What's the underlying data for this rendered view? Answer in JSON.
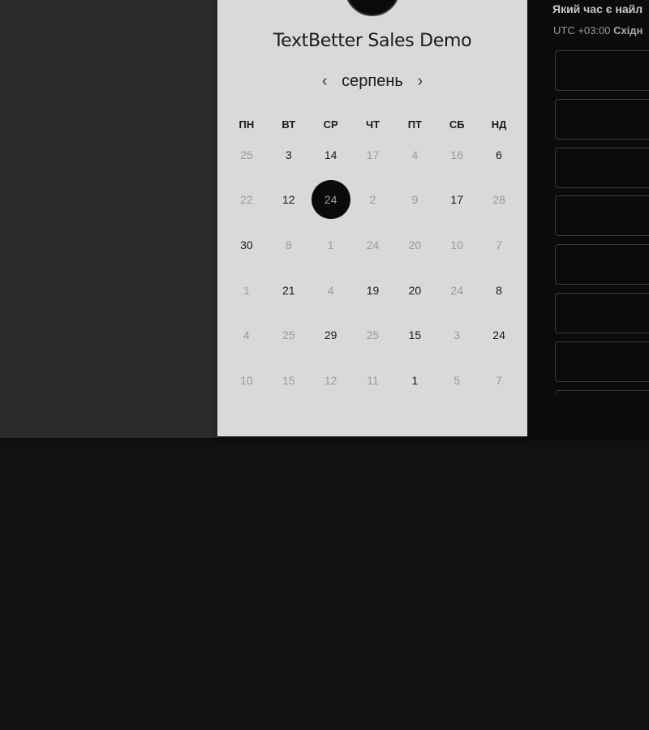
{
  "scheduler": {
    "title": "TextBetter Sales Demo",
    "month": "серпень",
    "prev_icon": "chevron-left-icon",
    "next_icon": "chevron-right-icon",
    "weekdays": [
      "ПН",
      "ВТ",
      "СР",
      "ЧТ",
      "ПТ",
      "СБ",
      "НД"
    ],
    "weeks": [
      [
        {
          "d": "25",
          "dim": true
        },
        {
          "d": "3",
          "dim": false
        },
        {
          "d": "14",
          "dim": false
        },
        {
          "d": "17",
          "dim": true
        },
        {
          "d": "4",
          "dim": true
        },
        {
          "d": "16",
          "dim": true
        },
        {
          "d": "6",
          "dim": false
        }
      ],
      [
        {
          "d": "22",
          "dim": true
        },
        {
          "d": "12",
          "dim": false
        },
        {
          "d": "24",
          "dim": false,
          "selected": true
        },
        {
          "d": "2",
          "dim": true
        },
        {
          "d": "9",
          "dim": true
        },
        {
          "d": "17",
          "dim": false
        },
        {
          "d": "28",
          "dim": true
        }
      ],
      [
        {
          "d": "30",
          "dim": false
        },
        {
          "d": "8",
          "dim": true
        },
        {
          "d": "1",
          "dim": true
        },
        {
          "d": "24",
          "dim": true
        },
        {
          "d": "20",
          "dim": true
        },
        {
          "d": "10",
          "dim": true
        },
        {
          "d": "7",
          "dim": true
        }
      ],
      [
        {
          "d": "1",
          "dim": true
        },
        {
          "d": "21",
          "dim": false
        },
        {
          "d": "4",
          "dim": true
        },
        {
          "d": "19",
          "dim": false
        },
        {
          "d": "20",
          "dim": false
        },
        {
          "d": "24",
          "dim": true
        },
        {
          "d": "8",
          "dim": false
        }
      ],
      [
        {
          "d": "4",
          "dim": true
        },
        {
          "d": "25",
          "dim": true
        },
        {
          "d": "29",
          "dim": false
        },
        {
          "d": "25",
          "dim": true
        },
        {
          "d": "15",
          "dim": false
        },
        {
          "d": "3",
          "dim": true
        },
        {
          "d": "24",
          "dim": false
        }
      ],
      [
        {
          "d": "10",
          "dim": true
        },
        {
          "d": "15",
          "dim": true
        },
        {
          "d": "12",
          "dim": true
        },
        {
          "d": "11",
          "dim": true
        },
        {
          "d": "1",
          "dim": false
        },
        {
          "d": "5",
          "dim": true
        },
        {
          "d": "7",
          "dim": true
        }
      ]
    ]
  },
  "time_panel": {
    "title": "Який час є найл",
    "timezone_prefix": "UTC +03:00",
    "timezone_name": "Східн",
    "slot_count": 7
  },
  "colors": {
    "card_bg": "#d9d9d9",
    "selected_bg": "#0a0a0a",
    "left_bg": "#2a2a2a",
    "right_bg": "#0b0b0b",
    "page_bg": "#121212"
  }
}
